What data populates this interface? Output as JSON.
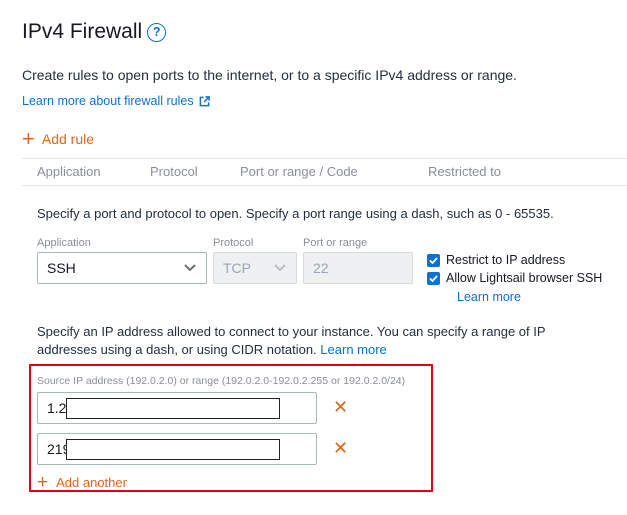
{
  "title": "IPv4 Firewall",
  "help_symbol": "?",
  "description": "Create rules to open ports to the internet, or to a specific IPv4 address or range.",
  "learn_more_firewall": "Learn more about firewall rules",
  "add_rule": "Add rule",
  "table_headers": [
    "Application",
    "Protocol",
    "Port or range / Code",
    "Restricted to"
  ],
  "port_instructions": "Specify a port and protocol to open. Specify a port range using a dash, such as 0 - 65535.",
  "fields": {
    "application_label": "Application",
    "application_value": "SSH",
    "protocol_label": "Protocol",
    "protocol_value": "TCP",
    "port_label": "Port or range",
    "port_value": "22"
  },
  "checkboxes": [
    {
      "label": "Restrict to IP address",
      "checked": true
    },
    {
      "label": "Allow Lightsail browser SSH",
      "checked": true
    }
  ],
  "learn_more": "Learn more",
  "ip_instructions": "Specify an IP address allowed to connect to your instance. You can specify a range of IP addresses using a dash, or using CIDR notation.",
  "ip_learn_more": "Learn more",
  "source_label": "Source IP address (192.0.2.0) or range (192.0.2.0-192.0.2.255 or 192.0.2.0/24)",
  "ip_entries": [
    "1.2",
    "219"
  ],
  "add_another": "Add another",
  "colors": {
    "accent_orange": "#e0661a",
    "link_blue": "#0972d3",
    "highlight_red": "#e3001b"
  }
}
